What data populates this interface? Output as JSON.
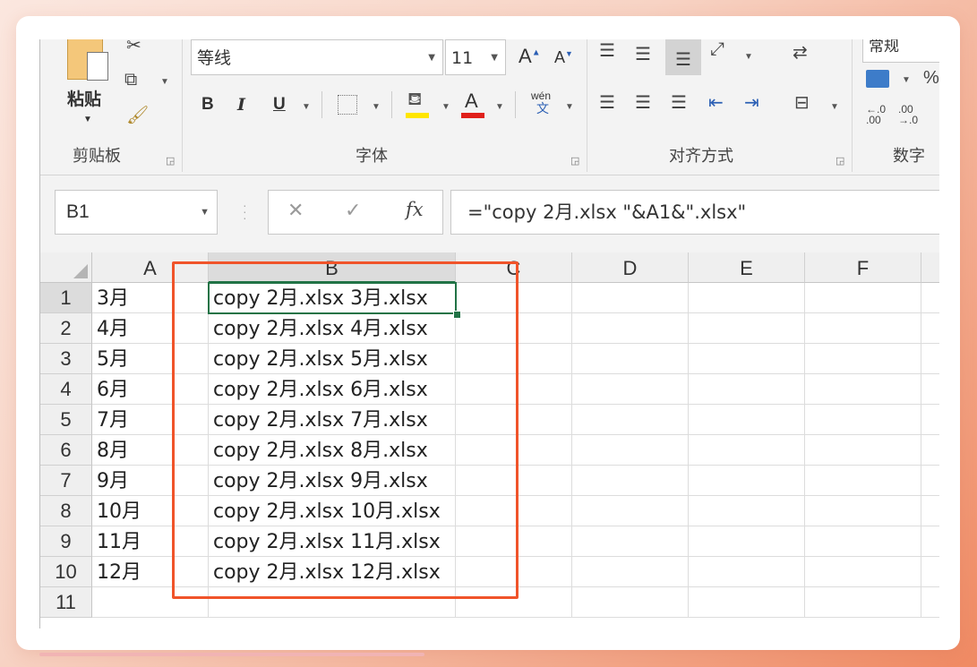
{
  "ribbon": {
    "clipboard": {
      "paste_label": "粘贴",
      "group_label": "剪贴板"
    },
    "font": {
      "font_name": "等线",
      "font_size": "11",
      "group_label": "字体",
      "bold": "B",
      "italic": "I",
      "underline": "U",
      "wen_top": "wén",
      "wen_bottom": "文",
      "increase": "A",
      "decrease": "A",
      "color_a": "A"
    },
    "alignment": {
      "group_label": "对齐方式"
    },
    "number": {
      "format_value": "常规",
      "group_label": "数字",
      "percent": "%"
    }
  },
  "formula_bar": {
    "name_box": "B1",
    "cancel": "✕",
    "enter": "✓",
    "fx": "fx",
    "formula": "=\"copy 2月.xlsx \"&A1&\".xlsx\""
  },
  "sheet": {
    "columns": [
      "A",
      "B",
      "C",
      "D",
      "E",
      "F"
    ],
    "rows": [
      {
        "n": "1",
        "a": "3月",
        "b": "copy 2月.xlsx 3月.xlsx"
      },
      {
        "n": "2",
        "a": "4月",
        "b": "copy 2月.xlsx 4月.xlsx"
      },
      {
        "n": "3",
        "a": "5月",
        "b": "copy 2月.xlsx 5月.xlsx"
      },
      {
        "n": "4",
        "a": "6月",
        "b": "copy 2月.xlsx 6月.xlsx"
      },
      {
        "n": "5",
        "a": "7月",
        "b": "copy 2月.xlsx 7月.xlsx"
      },
      {
        "n": "6",
        "a": "8月",
        "b": "copy 2月.xlsx 8月.xlsx"
      },
      {
        "n": "7",
        "a": "9月",
        "b": "copy 2月.xlsx 9月.xlsx"
      },
      {
        "n": "8",
        "a": "10月",
        "b": "copy 2月.xlsx 10月.xlsx"
      },
      {
        "n": "9",
        "a": "11月",
        "b": "copy 2月.xlsx 11月.xlsx"
      },
      {
        "n": "10",
        "a": "12月",
        "b": "copy 2月.xlsx 12月.xlsx"
      },
      {
        "n": "11",
        "a": "",
        "b": ""
      }
    ],
    "selected_cell": "B1"
  },
  "colors": {
    "highlight_rect": "#f0542a",
    "selection": "#217346",
    "font_color_bar": "#e0201b",
    "fill_color_bar": "#ffe600"
  }
}
